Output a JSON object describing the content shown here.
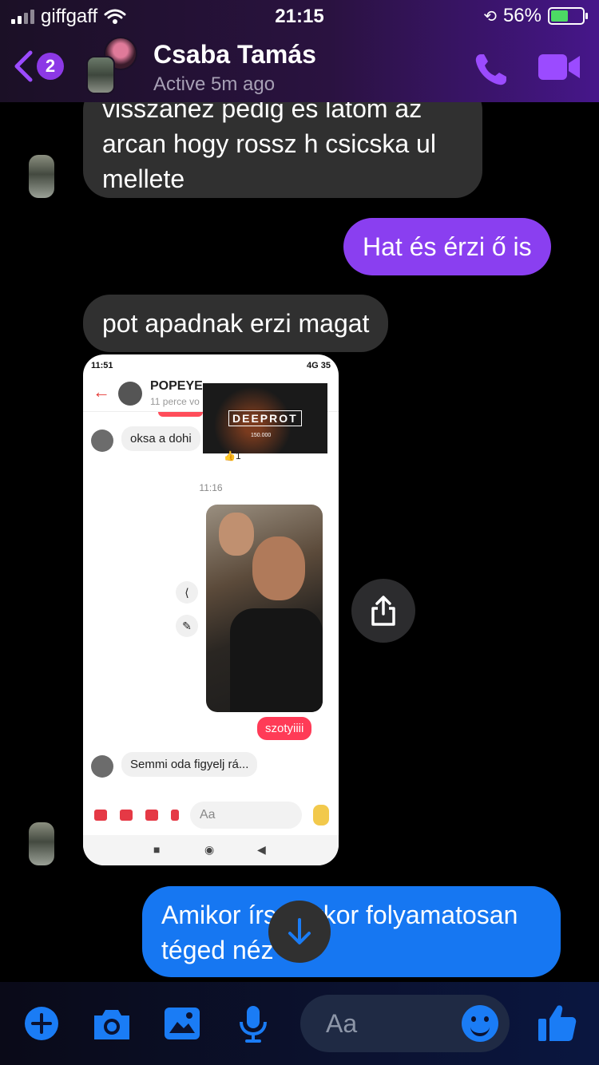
{
  "status": {
    "carrier": "giffgaff",
    "time": "21:15",
    "battery": "56%",
    "battery_level": 0.56
  },
  "header": {
    "back_badge": "2",
    "contact_name": "Csaba Tamás",
    "activity": "Active 5m ago"
  },
  "messages": [
    {
      "type": "incoming",
      "text_lines": [
        "visszanez pedig es latom az",
        "arcan hogy rossz h csicska ul",
        "mellete"
      ]
    },
    {
      "type": "outgoing",
      "text": "Hat és érzi ő is"
    },
    {
      "type": "incoming",
      "text": "pot apadnak erzi magat"
    },
    {
      "type": "incoming-image"
    },
    {
      "type": "outgoing",
      "text_lines": [
        "Amikor írsz akkor folyamatosan",
        "téged néz"
      ]
    }
  ],
  "screenshot": {
    "status_time": "11:51",
    "status_right": "4G 35",
    "contact": "POPEYE",
    "contact_sub": "11 perce vo",
    "ad_logo": "DEEPROT",
    "ad_count": "150.000",
    "msg1": "oksa a dohi",
    "reaction": "👍1",
    "time": "11:16",
    "photo_caption": "szotyiiii",
    "msg2": "Semmi oda figyelj rá...",
    "input_placeholder": "Aa"
  },
  "composer": {
    "placeholder": "Aa"
  },
  "colors": {
    "purple": "#8a3ff0",
    "blue": "#1677f2",
    "incoming": "#303030"
  }
}
